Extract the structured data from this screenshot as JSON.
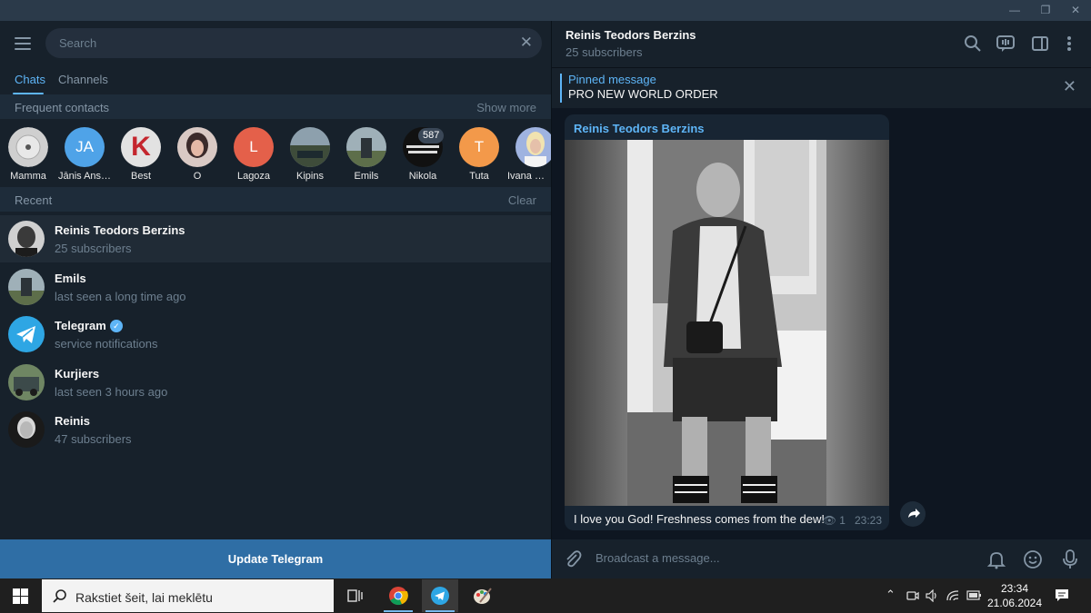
{
  "window": {
    "minimize": "—",
    "restore": "❐",
    "close": "✕"
  },
  "sidebar": {
    "search_placeholder": "Search",
    "tabs": [
      {
        "label": "Chats"
      },
      {
        "label": "Channels"
      }
    ],
    "frequent": {
      "title": "Frequent contacts",
      "action": "Show more",
      "contacts": [
        {
          "name": "Mamma",
          "initials": "",
          "color": "#c8c8c8"
        },
        {
          "name": "Jānis Ans…",
          "initials": "JA",
          "color": "#4fa3e8"
        },
        {
          "name": "Best",
          "initials": "K",
          "color": "#d8d8d8"
        },
        {
          "name": "O",
          "initials": "",
          "color": "#b07a7a"
        },
        {
          "name": "Lagoza",
          "initials": "L",
          "color": "#e4604a"
        },
        {
          "name": "Kipins",
          "initials": "",
          "color": "#5a6a58"
        },
        {
          "name": "Emils",
          "initials": "",
          "color": "#6b7f8a"
        },
        {
          "name": "Nikola",
          "initials": "",
          "color": "#1a1a1a"
        },
        {
          "name": "Tuta",
          "initials": "T",
          "color": "#f3994a"
        },
        {
          "name": "Ivana Ma…",
          "initials": "",
          "color": "#8aa0d8"
        }
      ],
      "badge": "587"
    },
    "recent": {
      "title": "Recent",
      "action": "Clear",
      "chats": [
        {
          "name": "Reinis Teodors Berzins",
          "status": "25 subscribers",
          "verified": false
        },
        {
          "name": "Emils",
          "status": "last seen a long time ago",
          "verified": false
        },
        {
          "name": "Telegram",
          "status": "service notifications",
          "verified": true
        },
        {
          "name": "Kurjiers",
          "status": "last seen 3 hours ago",
          "verified": false
        },
        {
          "name": "Reinis",
          "status": "47 subscribers",
          "verified": false
        }
      ]
    },
    "update_button": "Update Telegram"
  },
  "channel": {
    "title": "Reinis Teodors Berzins",
    "subtitle": "25 subscribers",
    "pinned": {
      "label": "Pinned message",
      "text": "PRO NEW WORLD ORDER"
    },
    "message": {
      "author": "Reinis Teodors Berzins",
      "caption": "I love you God! Freshness comes from the dew!",
      "views": "1",
      "time": "23:23"
    },
    "composer_placeholder": "Broadcast a message..."
  },
  "taskbar": {
    "search_text": "Rakstiet šeit, lai meklētu",
    "time": "23:34",
    "date": "21.06.2024"
  },
  "colors": {
    "accent": "#5eb5f7",
    "update": "#2f6ea5",
    "panel": "#17212b",
    "chat_bg": "#0e1621"
  }
}
